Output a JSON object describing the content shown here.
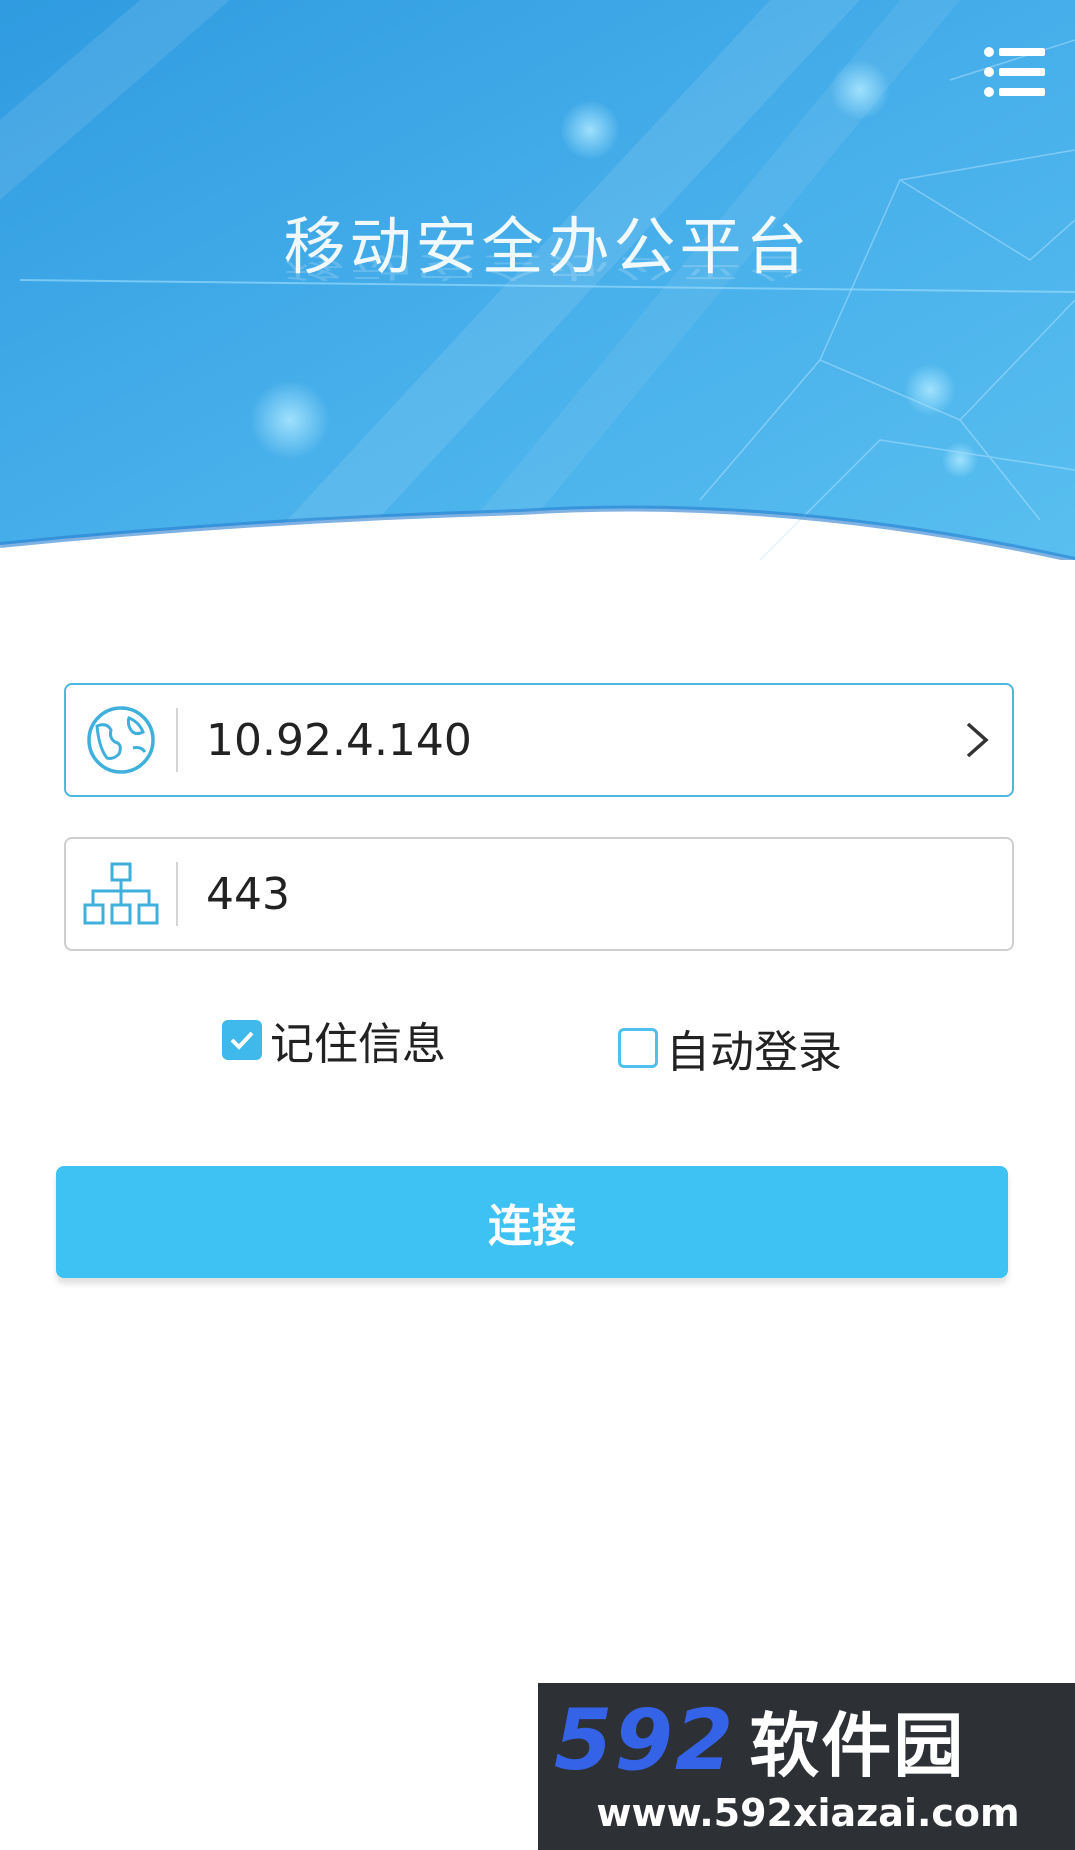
{
  "header": {
    "title": "移动安全办公平台",
    "menu_icon": "menu-list-icon"
  },
  "server_field": {
    "icon": "globe-icon",
    "value": "10.92.4.140",
    "arrow_icon": "chevron-right-icon"
  },
  "port_field": {
    "icon": "network-icon",
    "value": "443"
  },
  "options": {
    "remember": {
      "label": "记住信息",
      "checked": true
    },
    "auto_login": {
      "label": "自动登录",
      "checked": false
    }
  },
  "connect_button": {
    "label": "连接"
  },
  "watermark": {
    "number": "592",
    "name": "软件园",
    "url": "www.592xiazai.com"
  },
  "colors": {
    "accent": "#3ec1f3",
    "banner_light": "#5bc3f0",
    "banner_dark": "#2a8fd6",
    "active_border": "#4cb8e0"
  }
}
